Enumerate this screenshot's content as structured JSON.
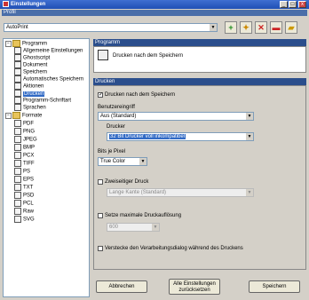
{
  "window": {
    "title": "Einstellungen",
    "minimize": "_",
    "maximize": "□",
    "close": "x"
  },
  "profile": {
    "label": "Profil",
    "value": "AutoPrint",
    "toolbar_icons": [
      "add-icon",
      "refresh-icon",
      "delete-icon",
      "save-icon",
      "folder-icon"
    ]
  },
  "tree": {
    "programm": "Programm",
    "programm_items": [
      "Allgemeine Einstellungen",
      "Ghostscript",
      "Dokument",
      "Speichern",
      "Automatisches Speichern",
      "Aktionen",
      "Drucken",
      "Programm-Schriftart",
      "Sprachen"
    ],
    "formate": "Formate",
    "formate_items": [
      "PDF",
      "PNG",
      "JPEG",
      "BMP",
      "PCX",
      "TIFF",
      "PS",
      "EPS",
      "TXT",
      "PSD",
      "PCL",
      "Raw",
      "SVG"
    ]
  },
  "programm_header": "Programm",
  "programm_desc": "Drucken nach dem Speichern",
  "drucken_header": "Drucken",
  "settings": {
    "print_after_save": "Drucken nach dem Speichern",
    "print_after_save_checked": true,
    "user_action_label": "Benutzereingriff",
    "user_action_value": "Aus (Standard)",
    "printer_label": "Drucker",
    "printer_value": "32 Bit Drucker voll inkompatibel",
    "bits_label": "Bits je Pixel",
    "bits_value": "True Color",
    "duplex_label": "Zweiseitiger Druck",
    "duplex_checked": false,
    "duplex_value": "Lange Kante (Standard)",
    "max_res_label": "Setze maximale Druckauflösung",
    "max_res_checked": false,
    "max_res_value": "600",
    "hide_dialog_label": "Verstecke den Verarbeitungsdialog während des Druckens",
    "hide_dialog_checked": false
  },
  "buttons": {
    "cancel": "Abbrechen",
    "reset": "Alle Einstellungen zurücksetzen",
    "save": "Speichern"
  }
}
